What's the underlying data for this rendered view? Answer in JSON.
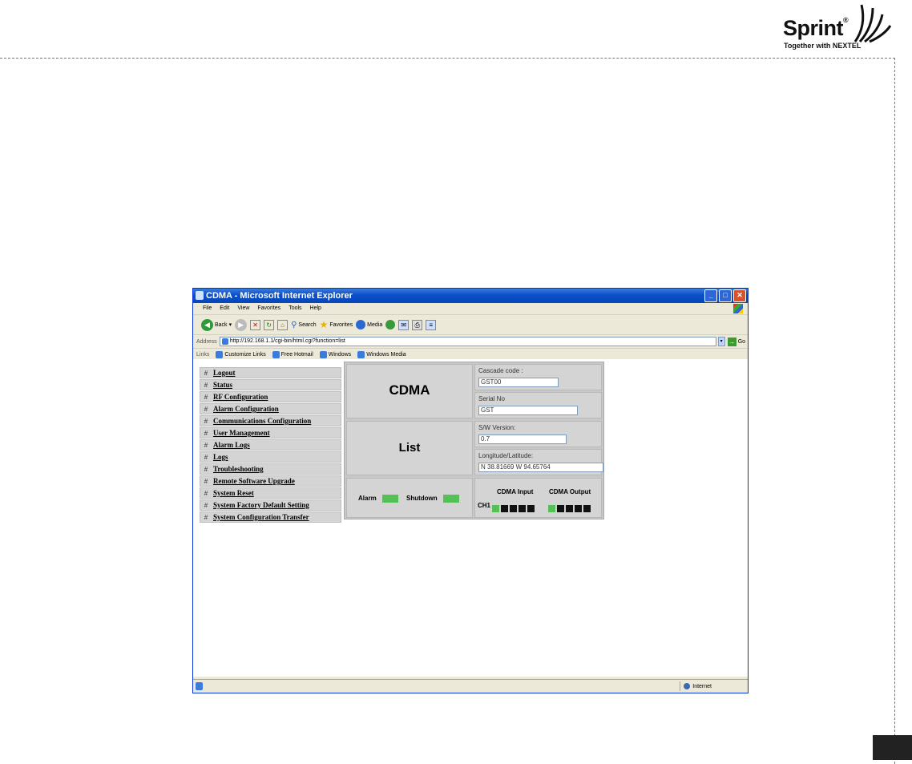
{
  "brand": {
    "name": "Sprint",
    "tagline": "Together with NEXTEL"
  },
  "browser": {
    "title": "CDMA - Microsoft Internet Explorer",
    "menu": [
      "File",
      "Edit",
      "View",
      "Favorites",
      "Tools",
      "Help"
    ],
    "toolbar": {
      "back": "Back",
      "search": "Search",
      "favorites": "Favorites",
      "media": "Media"
    },
    "address": {
      "label": "Address",
      "url": "http://192.168.1.1/cgi-bin/html.cgi?function=list",
      "go": "Go"
    },
    "links": {
      "label": "Links",
      "items": [
        "Customize Links",
        "Free Hotmail",
        "Windows",
        "Windows Media"
      ]
    },
    "status": {
      "zone": "Internet"
    }
  },
  "nav": {
    "hash": "#",
    "items": [
      "Logout",
      "Status",
      "RF Configuration",
      "Alarm Configuration",
      "Communications Configuration",
      "User Management",
      "Alarm Logs",
      "Logs",
      "Troubleshooting",
      "Remote Software Upgrade",
      "System Reset",
      "System Factory Default Setting",
      "System Configuration Transfer"
    ]
  },
  "panel": {
    "product": "CDMA",
    "page": "List",
    "cascade_label": "Cascade code :",
    "cascade_value": "GST00",
    "serial_label": "Serial No",
    "serial_value": "GST",
    "sw_label": "S/W Version:",
    "sw_value": "0.7",
    "lonlat_label": "Longitude/Latitude:",
    "lonlat_value": "N 38.81669 W 94.65764",
    "alarm_label": "Alarm",
    "shutdown_label": "Shutdown",
    "input_label": "CDMA Input",
    "output_label": "CDMA Output",
    "channel": "CH1",
    "colors": {
      "led_on": "#55c055",
      "led_off": "#111111"
    }
  }
}
